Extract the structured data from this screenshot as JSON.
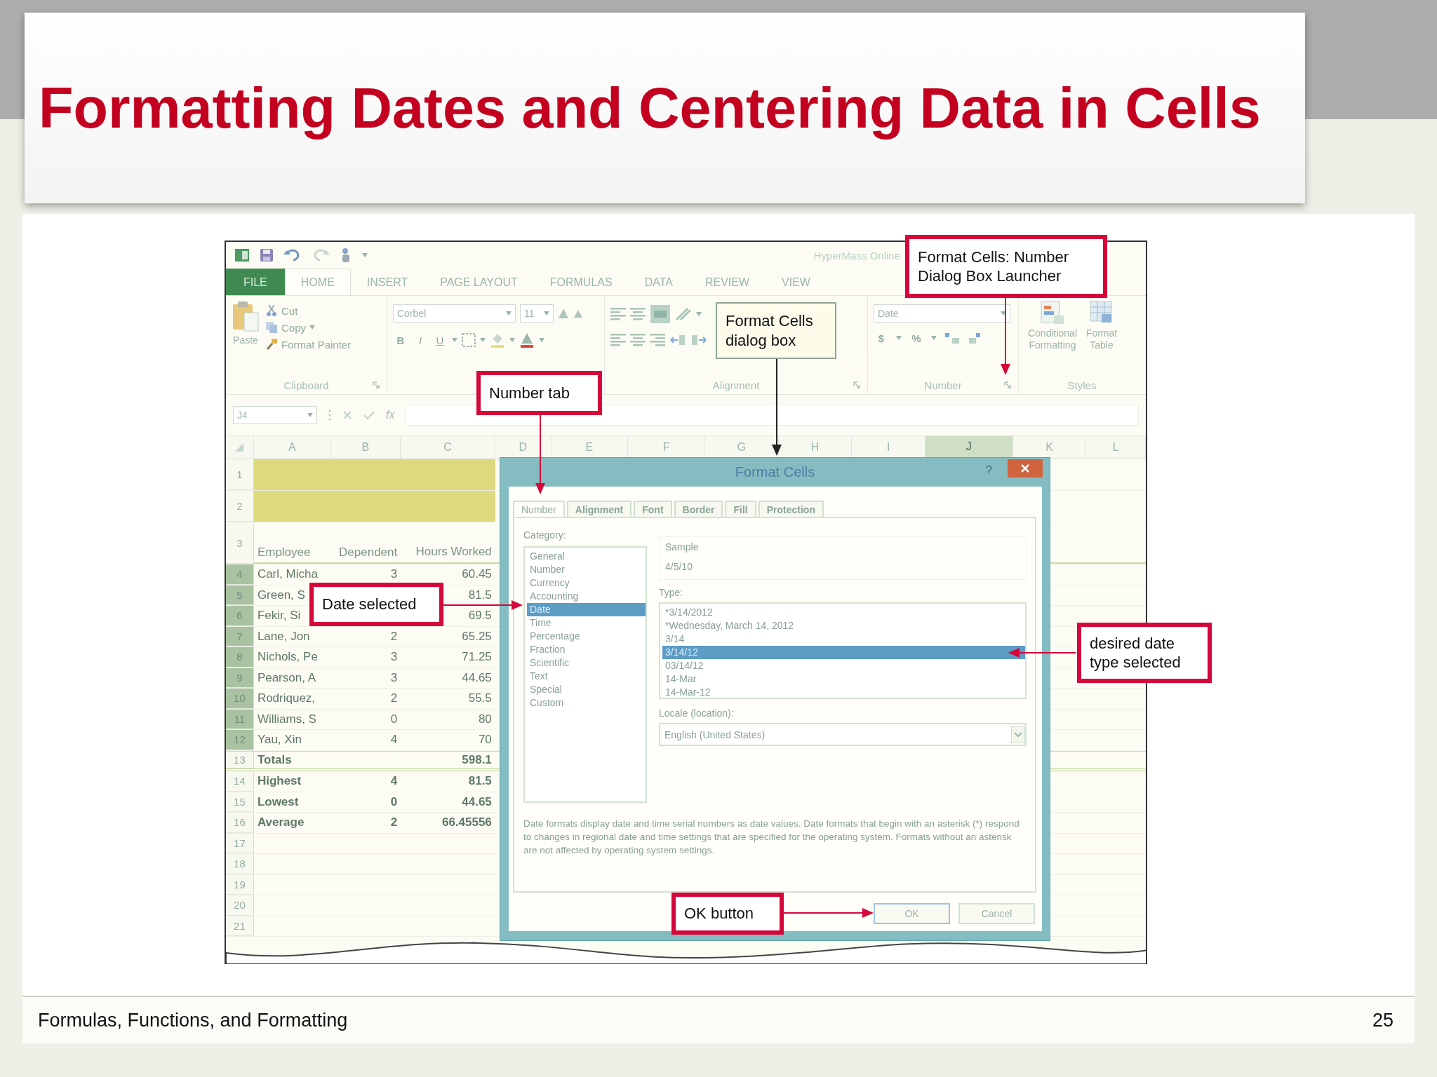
{
  "slide": {
    "title": "Formatting Dates and Centering Data in Cells",
    "footer": "Formulas, Functions, and Formatting",
    "page_number": "25"
  },
  "excel": {
    "quick_access": {
      "document_title": "HyperMass Online"
    },
    "ribbon_tabs": [
      {
        "label": "FILE",
        "kind": "file",
        "selected": false
      },
      {
        "label": "HOME",
        "kind": "tab",
        "selected": true
      },
      {
        "label": "INSERT",
        "kind": "tab",
        "selected": false
      },
      {
        "label": "PAGE LAYOUT",
        "kind": "tab",
        "selected": false
      },
      {
        "label": "FORMULAS",
        "kind": "tab",
        "selected": false
      },
      {
        "label": "DATA",
        "kind": "tab",
        "selected": false
      },
      {
        "label": "REVIEW",
        "kind": "tab",
        "selected": false
      },
      {
        "label": "VIEW",
        "kind": "tab",
        "selected": false
      }
    ],
    "clipboard": {
      "paste": "Paste",
      "cut": "Cut",
      "copy": "Copy",
      "format_painter": "Format Painter",
      "group": "Clipboard"
    },
    "font": {
      "name": "Corbel",
      "size": "11",
      "bold": "B",
      "italic": "I",
      "underline": "U"
    },
    "alignment": {
      "group": "Alignment"
    },
    "number": {
      "format": "Date",
      "currency": "$",
      "percent": "%",
      "group": "Number"
    },
    "styles": {
      "conditional_formatting": "Conditional Formatting",
      "format_table": "Format Table",
      "group": "Styles"
    },
    "formula_bar": {
      "name_box": "J4",
      "function_label": "fx"
    },
    "columns": [
      {
        "label": "A",
        "selected": false
      },
      {
        "label": "B",
        "selected": false
      },
      {
        "label": "C",
        "selected": false
      },
      {
        "label": "D",
        "selected": false
      },
      {
        "label": "E",
        "selected": false
      },
      {
        "label": "F",
        "selected": false
      },
      {
        "label": "G",
        "selected": false
      },
      {
        "label": "H",
        "selected": false
      },
      {
        "label": "I",
        "selected": false
      },
      {
        "label": "J",
        "selected": true
      },
      {
        "label": "K",
        "selected": false
      },
      {
        "label": "L",
        "selected": false
      }
    ],
    "rows": [
      {
        "number": "1",
        "selected": false,
        "kind": "band",
        "cells": []
      },
      {
        "number": "2",
        "selected": false,
        "kind": "band",
        "cells": []
      },
      {
        "number": "3",
        "selected": false,
        "kind": "header",
        "cells": [
          "Employee",
          "Dependent",
          "Hours Worked"
        ]
      },
      {
        "number": "4",
        "selected": true,
        "kind": "data",
        "cells": [
          "Carl, Micha",
          "3",
          "60.45"
        ]
      },
      {
        "number": "5",
        "selected": true,
        "kind": "data",
        "cells": [
          "Green, S",
          null,
          "81.5"
        ]
      },
      {
        "number": "6",
        "selected": true,
        "kind": "data",
        "cells": [
          "Fekir, Si",
          null,
          "69.5"
        ]
      },
      {
        "number": "7",
        "selected": true,
        "kind": "data",
        "cells": [
          "Lane, Jon",
          "2",
          "65.25"
        ]
      },
      {
        "number": "8",
        "selected": true,
        "kind": "data",
        "cells": [
          "Nichols, Pe",
          "3",
          "71.25"
        ]
      },
      {
        "number": "9",
        "selected": true,
        "kind": "data",
        "cells": [
          "Pearson, A",
          "3",
          "44.65"
        ]
      },
      {
        "number": "10",
        "selected": true,
        "kind": "data",
        "cells": [
          "Rodriquez,",
          "2",
          "55.5"
        ]
      },
      {
        "number": "11",
        "selected": true,
        "kind": "data",
        "cells": [
          "Williams, S",
          "0",
          "80"
        ]
      },
      {
        "number": "12",
        "selected": true,
        "kind": "data",
        "cells": [
          "Yau, Xin",
          "4",
          "70"
        ]
      },
      {
        "number": "13",
        "selected": false,
        "kind": "total",
        "cells": [
          "Totals",
          null,
          "598.1"
        ]
      },
      {
        "number": "14",
        "selected": false,
        "kind": "stat",
        "cells": [
          "Highest",
          "4",
          "81.5"
        ]
      },
      {
        "number": "15",
        "selected": false,
        "kind": "stat",
        "cells": [
          "Lowest",
          "0",
          "44.65"
        ]
      },
      {
        "number": "16",
        "selected": false,
        "kind": "stat",
        "cells": [
          "Average",
          "2",
          "66.45556"
        ]
      },
      {
        "number": "17",
        "selected": false,
        "kind": "empty",
        "cells": []
      },
      {
        "number": "18",
        "selected": false,
        "kind": "empty",
        "cells": []
      },
      {
        "number": "19",
        "selected": false,
        "kind": "empty",
        "cells": []
      },
      {
        "number": "20",
        "selected": false,
        "kind": "empty",
        "cells": []
      },
      {
        "number": "21",
        "selected": false,
        "kind": "empty",
        "cells": []
      }
    ],
    "dialog": {
      "title": "Format Cells",
      "help": "?",
      "tabs": [
        {
          "label": "Number",
          "selected": true
        },
        {
          "label": "Alignment",
          "selected": false
        },
        {
          "label": "Font",
          "selected": false
        },
        {
          "label": "Border",
          "selected": false
        },
        {
          "label": "Fill",
          "selected": false
        },
        {
          "label": "Protection",
          "selected": false
        }
      ],
      "category_label": "Category:",
      "categories": [
        {
          "label": "General",
          "selected": false
        },
        {
          "label": "Number",
          "selected": false
        },
        {
          "label": "Currency",
          "selected": false
        },
        {
          "label": "Accounting",
          "selected": false
        },
        {
          "label": "Date",
          "selected": true
        },
        {
          "label": "Time",
          "selected": false
        },
        {
          "label": "Percentage",
          "selected": false
        },
        {
          "label": "Fraction",
          "selected": false
        },
        {
          "label": "Scientific",
          "selected": false
        },
        {
          "label": "Text",
          "selected": false
        },
        {
          "label": "Special",
          "selected": false
        },
        {
          "label": "Custom",
          "selected": false
        }
      ],
      "sample_label": "Sample",
      "sample": "4/5/10",
      "type_label": "Type:",
      "types": [
        {
          "label": "*3/14/2012",
          "selected": false
        },
        {
          "label": "*Wednesday, March 14, 2012",
          "selected": false
        },
        {
          "label": "3/14",
          "selected": false
        },
        {
          "label": "3/14/12",
          "selected": true
        },
        {
          "label": "03/14/12",
          "selected": false
        },
        {
          "label": "14-Mar",
          "selected": false
        },
        {
          "label": "14-Mar-12",
          "selected": false
        }
      ],
      "locale_label": "Locale (location):",
      "locale": "English (United States)",
      "description": "Date formats display date and time serial numbers as date values.  Date formats that begin with an asterisk (*) respond to changes in regional date and time settings that are specified for the operating system. Formats without an asterisk are not affected by operating system settings.",
      "buttons": [
        {
          "label": "OK",
          "kind": "default"
        },
        {
          "label": "Cancel",
          "kind": "normal"
        }
      ]
    }
  },
  "callouts": [
    {
      "text": "Format Cells: Number Dialog Box Launcher",
      "kind": "red"
    },
    {
      "text": "Format Cells dialog box",
      "kind": "plain"
    },
    {
      "text": "Number tab",
      "kind": "red"
    },
    {
      "text": "Date selected",
      "kind": "red"
    },
    {
      "text": "desired date type selected",
      "kind": "red"
    },
    {
      "text": "OK button",
      "kind": "red"
    }
  ]
}
